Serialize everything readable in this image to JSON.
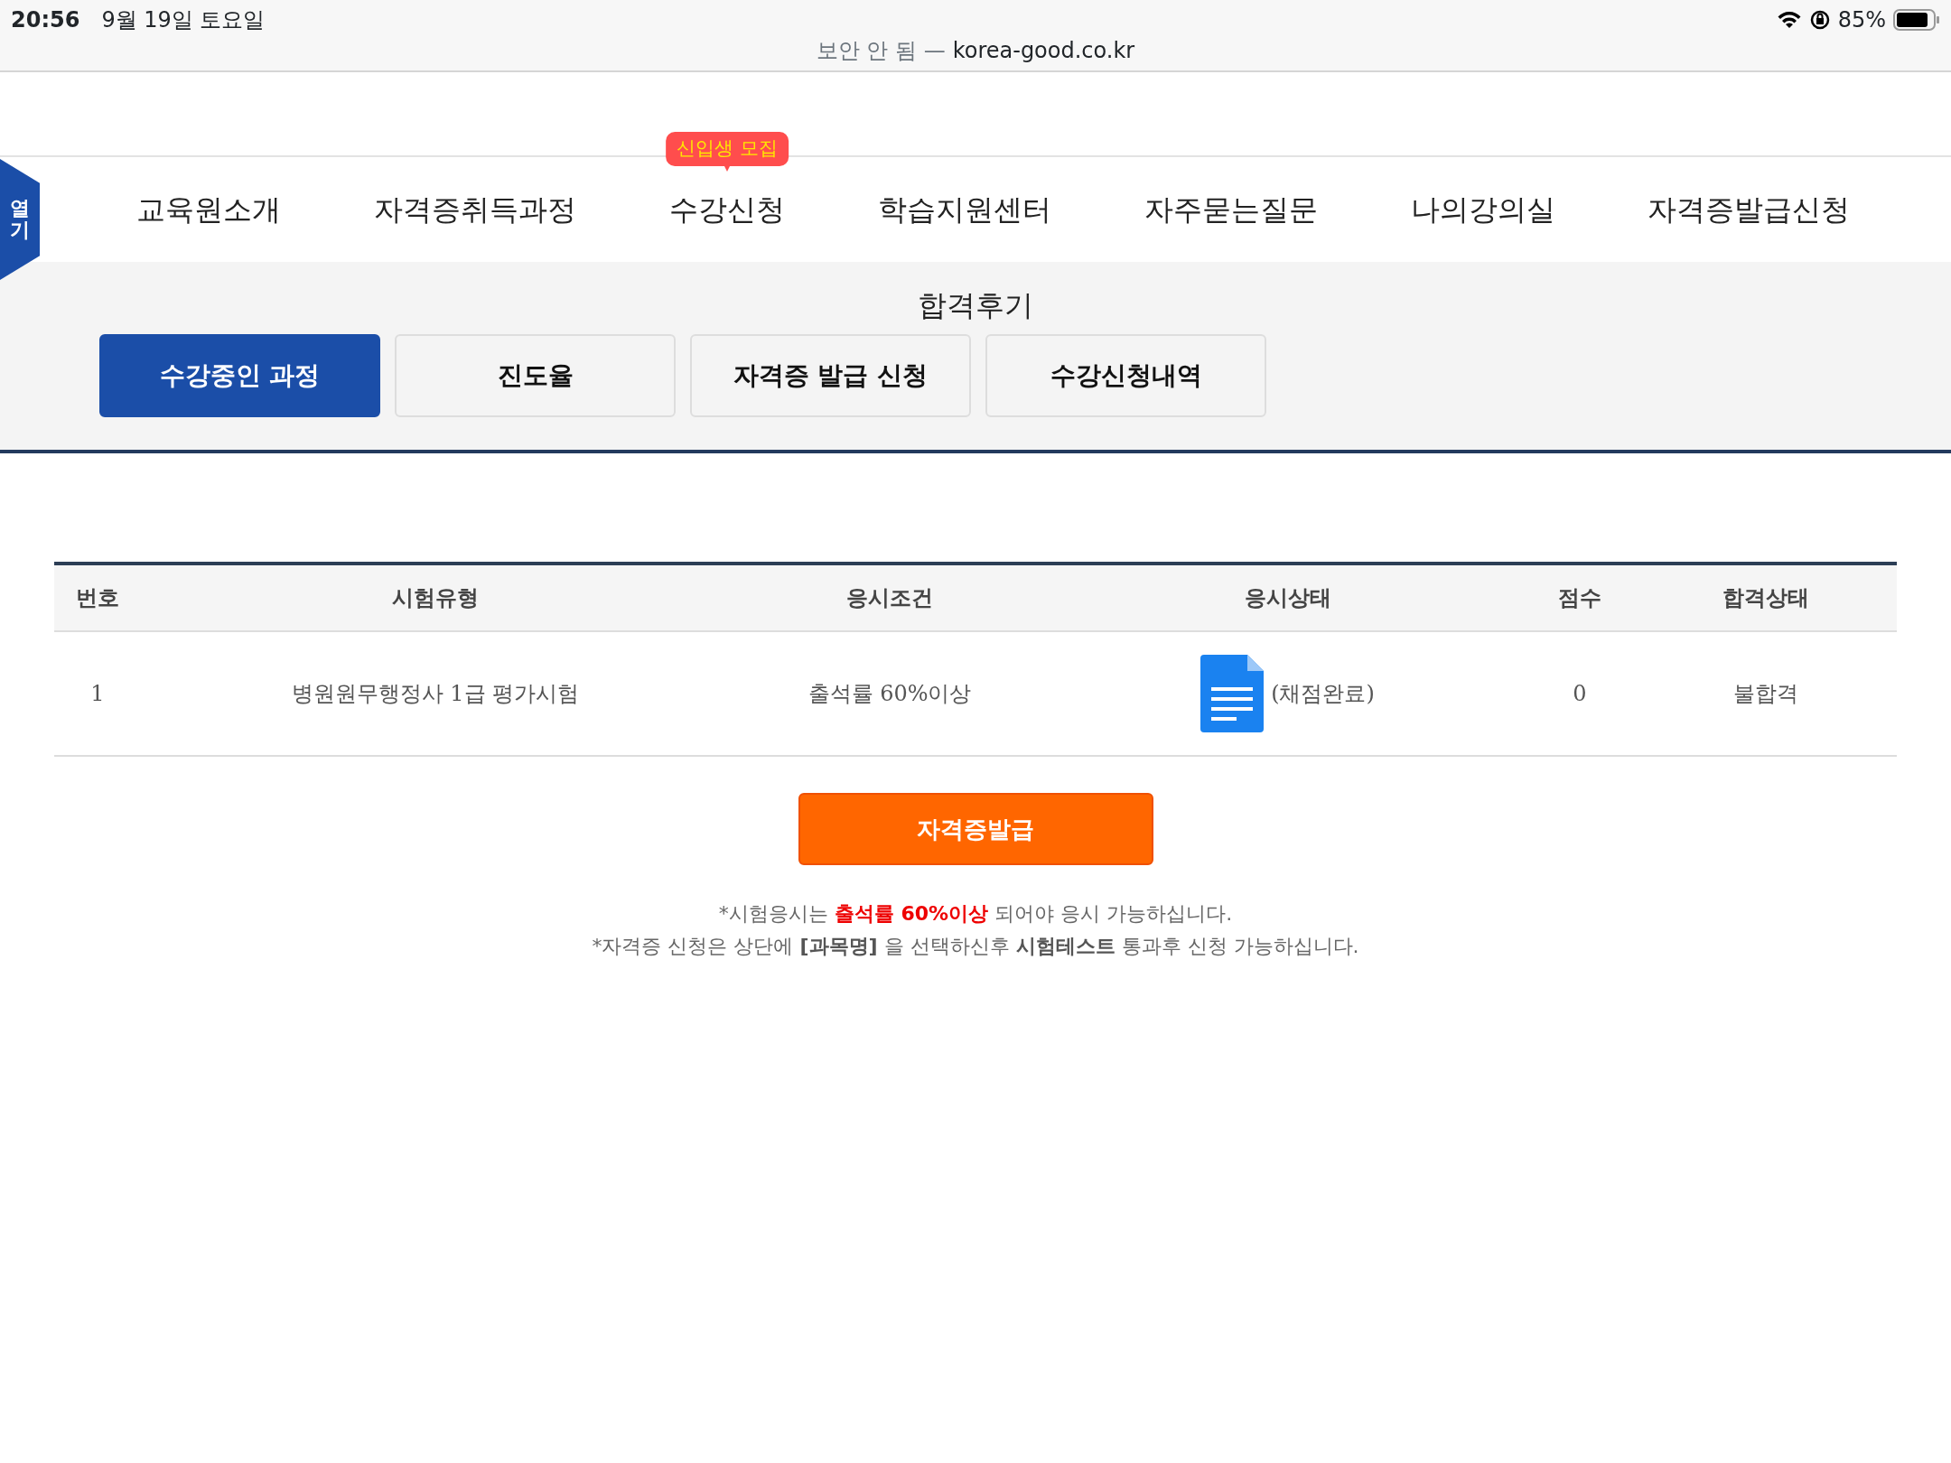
{
  "status_bar": {
    "time": "20:56",
    "date": "9월 19일 토요일",
    "battery": "85%"
  },
  "address_bar": {
    "security": "보안 안 됨 —",
    "domain": "korea-good.co.kr"
  },
  "side_tab": {
    "label": "열기"
  },
  "nav": {
    "items": [
      {
        "label": "교육원소개"
      },
      {
        "label": "자격증취득과정"
      },
      {
        "label": "수강신청",
        "badge": "신입생 모집"
      },
      {
        "label": "학습지원센터"
      },
      {
        "label": "자주묻는질문"
      },
      {
        "label": "나의강의실"
      },
      {
        "label": "자격증발급신청"
      }
    ]
  },
  "section_title": "합격후기",
  "tabs": [
    {
      "label": "수강중인 과정",
      "selected": true
    },
    {
      "label": "진도율",
      "selected": false
    },
    {
      "label": "자격증 발급 신청",
      "selected": false
    },
    {
      "label": "수강신청내역",
      "selected": false
    }
  ],
  "table": {
    "columns": [
      "번호",
      "시험유형",
      "응시조건",
      "응시상태",
      "점수",
      "합격상태"
    ],
    "rows": [
      {
        "number": "1",
        "exam_type": "병원원무행정사 1급 평가시험",
        "condition": "출석률 60%이상",
        "status": "(채점완료)",
        "score": "0",
        "result": "불합격"
      }
    ]
  },
  "issue_button": "자격증발급",
  "notes": [
    {
      "kind": "warning",
      "text": "*시험응시는 **출석률 60%이상** 되어야 응시 가능하십니다."
    },
    {
      "kind": "info",
      "text": "*자격증 신청은 상단에 **[과목명]** 을 선택하신후 **시험테스트** 통과후 신청 가능하십니다."
    }
  ]
}
